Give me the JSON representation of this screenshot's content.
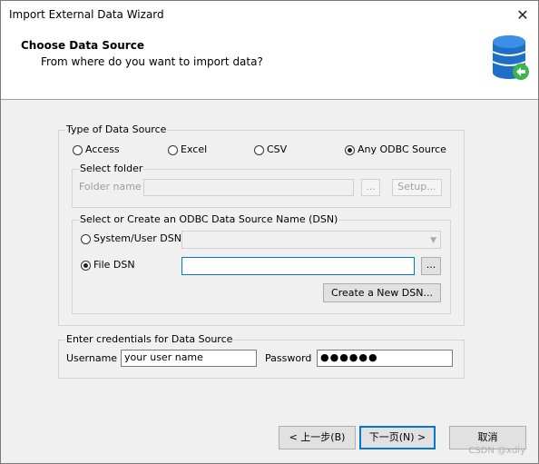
{
  "window": {
    "title": "Import External Data Wizard",
    "close_glyph": "✕"
  },
  "header": {
    "title": "Choose Data Source",
    "subtitle": "From where do you want to import data?"
  },
  "source_type": {
    "legend": "Type of Data Source",
    "options": [
      "Access",
      "Excel",
      "CSV",
      "Any ODBC Source"
    ],
    "selected": "Any ODBC Source"
  },
  "select_folder": {
    "legend": "Select folder",
    "folder_label": "Folder name",
    "folder_value": "",
    "browse_label": "...",
    "setup_label": "Setup..."
  },
  "dsn": {
    "legend": "Select or Create an ODBC Data Source Name (DSN)",
    "system_user_label": "System/User DSN",
    "system_user_value": "",
    "file_dsn_label": "File DSN",
    "file_dsn_value": "",
    "browse_label": "...",
    "create_label": "Create a New DSN..."
  },
  "credentials": {
    "legend": "Enter credentials for Data Source",
    "username_label": "Username",
    "username_value": "your user name",
    "password_label": "Password",
    "password_value": "●●●●●●"
  },
  "footer": {
    "back_label": "< 上一步(B)",
    "next_label": "下一页(N) >",
    "cancel_label": "取消"
  },
  "watermark": "CSDN @xdiy"
}
